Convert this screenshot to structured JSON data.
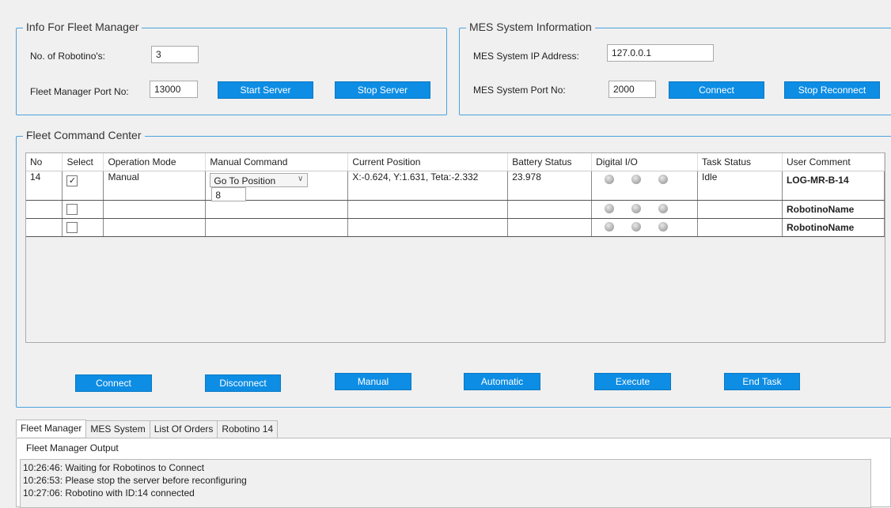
{
  "fleet_info": {
    "title": "Info For Fleet Manager",
    "robotino_count_label": "No. of Robotino's:",
    "robotino_count_value": "3",
    "port_label": "Fleet Manager Port No:",
    "port_value": "13000",
    "start_server": "Start Server",
    "stop_server": "Stop Server"
  },
  "mes_info": {
    "title": "MES System Information",
    "ip_label": "MES System IP Address:",
    "ip_value": "127.0.0.1",
    "port_label": "MES System Port No:",
    "port_value": "2000",
    "connect": "Connect",
    "stop_reconnect": "Stop Reconnect"
  },
  "command_center": {
    "title": "Fleet Command Center",
    "columns": [
      "No",
      "Select",
      "Operation Mode",
      "Manual Command",
      "Current Position",
      "Battery Status",
      "Digital I/O",
      "Task Status",
      "User Comment"
    ],
    "rows": [
      {
        "no": "14",
        "checked": true,
        "check_mark": "✓",
        "mode": "Manual",
        "command": "Go To Position",
        "command_arg": "8",
        "position": "X:-0.624, Y:1.631, Teta:-2.332",
        "battery": "23.978",
        "task": "Idle",
        "comment": "LOG-MR-B-14"
      },
      {
        "no": "",
        "checked": false,
        "check_mark": "",
        "mode": "",
        "command": "",
        "command_arg": "",
        "position": "",
        "battery": "",
        "task": "",
        "comment": "RobotinoName"
      },
      {
        "no": "",
        "checked": false,
        "check_mark": "",
        "mode": "",
        "command": "",
        "command_arg": "",
        "position": "",
        "battery": "",
        "task": "",
        "comment": "RobotinoName"
      }
    ],
    "buttons": {
      "connect": "Connect",
      "disconnect": "Disconnect",
      "manual": "Manual",
      "automatic": "Automatic",
      "execute": "Execute",
      "end_task": "End Task"
    }
  },
  "tabs": [
    "Fleet Manager",
    "MES System",
    "List Of Orders",
    "Robotino 14"
  ],
  "output": {
    "title": "Fleet Manager Output",
    "lines": [
      "10:26:46: Waiting for Robotinos to Connect",
      "10:26:53: Please stop the server before reconfiguring",
      "10:27:06: Robotino with ID:14 connected"
    ]
  },
  "colors": {
    "accent": "#0d8de3",
    "group_border": "#4aa3df"
  }
}
